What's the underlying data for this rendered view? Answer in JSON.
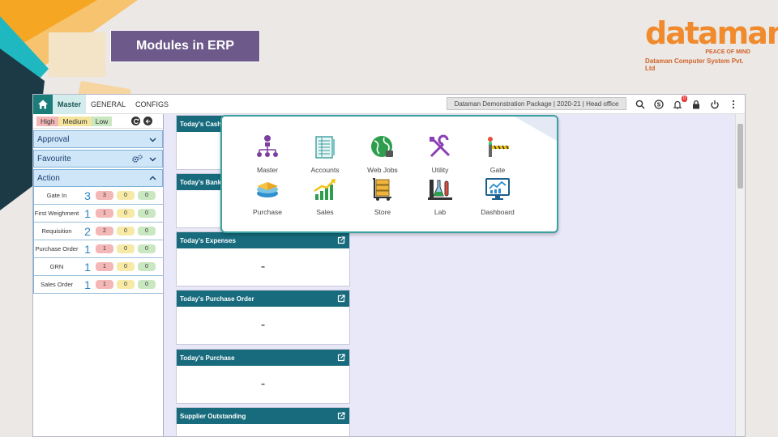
{
  "slide": {
    "title": "Modules in ERP",
    "logo_word": "dataman",
    "logo_tagline": "PEACE OF MIND",
    "logo_company": "Dataman Computer System Pvt. Ltd"
  },
  "topbar": {
    "tabs": [
      {
        "label": "Master",
        "active": true
      },
      {
        "label": "GENERAL",
        "active": false
      },
      {
        "label": "CONFIGS",
        "active": false
      }
    ],
    "package": "Dataman Demonstration Package | 2020-21 | Head office",
    "notification_count": "0"
  },
  "sidebar": {
    "priority": {
      "high": "High",
      "medium": "Medium",
      "low": "Low"
    },
    "sections": {
      "approval": "Approval",
      "favourite": "Favourite",
      "action": "Action"
    },
    "action_rows": [
      {
        "label": "Gate In",
        "count": "3",
        "high": "3",
        "medium": "0",
        "low": "0"
      },
      {
        "label": "First Weighment",
        "count": "1",
        "high": "1",
        "medium": "0",
        "low": "0"
      },
      {
        "label": "Requisition",
        "count": "2",
        "high": "2",
        "medium": "0",
        "low": "0"
      },
      {
        "label": "Purchase Order",
        "count": "1",
        "high": "1",
        "medium": "0",
        "low": "0"
      },
      {
        "label": "GRN",
        "count": "1",
        "high": "1",
        "medium": "0",
        "low": "0"
      },
      {
        "label": "Sales Order",
        "count": "1",
        "high": "1",
        "medium": "0",
        "low": "0"
      }
    ]
  },
  "widgets": [
    {
      "title": "Today's Cash",
      "value": ""
    },
    {
      "title": "Today's Bank",
      "value": ""
    },
    {
      "title": "Today's Expenses",
      "value": "-"
    },
    {
      "title": "Today's Purchase Order",
      "value": "-"
    },
    {
      "title": "Today's Purchase",
      "value": "-"
    },
    {
      "title": "Supplier Outstanding",
      "value": ""
    }
  ],
  "modules": [
    {
      "label": "Master",
      "icon": "hierarchy-icon"
    },
    {
      "label": "Accounts",
      "icon": "ledger-icon"
    },
    {
      "label": "Web Jobs",
      "icon": "globe-icon"
    },
    {
      "label": "Utility",
      "icon": "tools-icon"
    },
    {
      "label": "Gate",
      "icon": "barrier-gate-icon"
    },
    {
      "label": "Purchase",
      "icon": "stack-icon"
    },
    {
      "label": "Sales",
      "icon": "growth-chart-icon"
    },
    {
      "label": "Store",
      "icon": "warehouse-trolley-icon"
    },
    {
      "label": "Lab",
      "icon": "lab-flask-icon"
    },
    {
      "label": "Dashboard",
      "icon": "monitor-chart-icon"
    }
  ],
  "colors": {
    "accent": "#176b7d",
    "title_box": "#6e5a8a",
    "logo": "#f08a2c"
  }
}
